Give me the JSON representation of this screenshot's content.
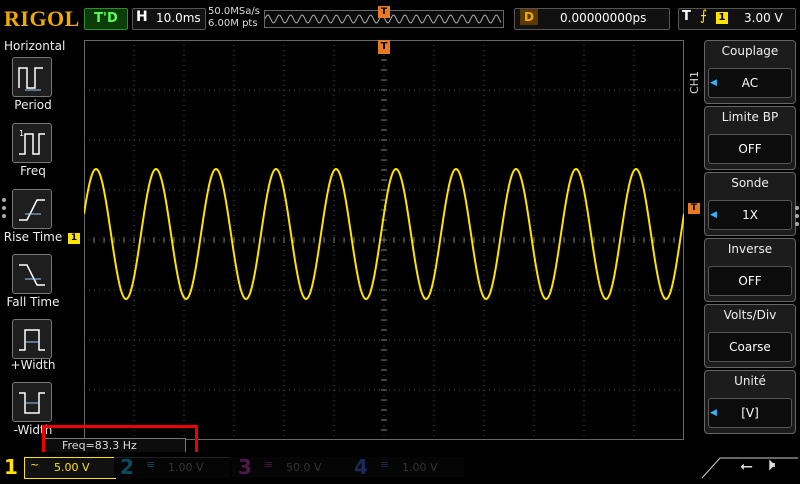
{
  "top_bar": {
    "logo": "RIGOL",
    "run_state": "T'D",
    "horizontal_label": "H",
    "timebase": "10.0ms",
    "sample_rate": "50.0MSa/s",
    "memory_depth": "6.00M pts",
    "trigger_marker": "T",
    "delay_label": "D",
    "delay_value": "0.00000000ps",
    "trigger_label": "T",
    "trigger_edge": "⨍",
    "trigger_source": "1",
    "trigger_level": "3.00 V"
  },
  "left_panel": {
    "title": "Horizontal",
    "items": [
      {
        "label": "Period",
        "icon": "period-icon"
      },
      {
        "label": "Freq",
        "icon": "freq-icon"
      },
      {
        "label": "Rise Time",
        "icon": "rise-time-icon"
      },
      {
        "label": "Fall Time",
        "icon": "fall-time-icon"
      },
      {
        "label": "+Width",
        "icon": "pos-width-icon"
      },
      {
        "label": "-Width",
        "icon": "neg-width-icon"
      }
    ]
  },
  "screen": {
    "channel1_marker": "1",
    "trigger_level_marker": "T",
    "trigger_position_marker": "T",
    "measurement": "Freq=83.3 Hz"
  },
  "waveform": {
    "channel": "CH1",
    "color": "#ffe200",
    "cycles_displayed": 10,
    "amplitude_divs": 1.3
  },
  "right_panel": {
    "channel_tag": "CH1",
    "groups": [
      {
        "title": "Couplage",
        "value": "AC"
      },
      {
        "title": "Limite BP",
        "value": "OFF"
      },
      {
        "title": "Sonde",
        "value": "1X"
      },
      {
        "title": "Inverse",
        "value": "OFF"
      },
      {
        "title": "Volts/Div",
        "value": "Coarse"
      },
      {
        "title": "Unité",
        "value": "[V]"
      }
    ]
  },
  "bottom_bar": {
    "channels": [
      {
        "num": "1",
        "coupling": "~",
        "volts": "5.00 V",
        "color": "#ffe200"
      },
      {
        "num": "2",
        "coupling": "≡",
        "volts": "1.00 V",
        "color": "#00c8ff"
      },
      {
        "num": "3",
        "coupling": "≡",
        "volts": "50.0 V",
        "color": "#d040d0"
      },
      {
        "num": "4",
        "coupling": "≡",
        "volts": "1.00 V",
        "color": "#2060ff"
      }
    ],
    "usb_icon": "usb-icon",
    "speaker_icon": "speaker-muted-icon"
  },
  "colors": {
    "accent": "#f2a900",
    "ch1": "#ffe200",
    "highlight": "#e00000"
  }
}
